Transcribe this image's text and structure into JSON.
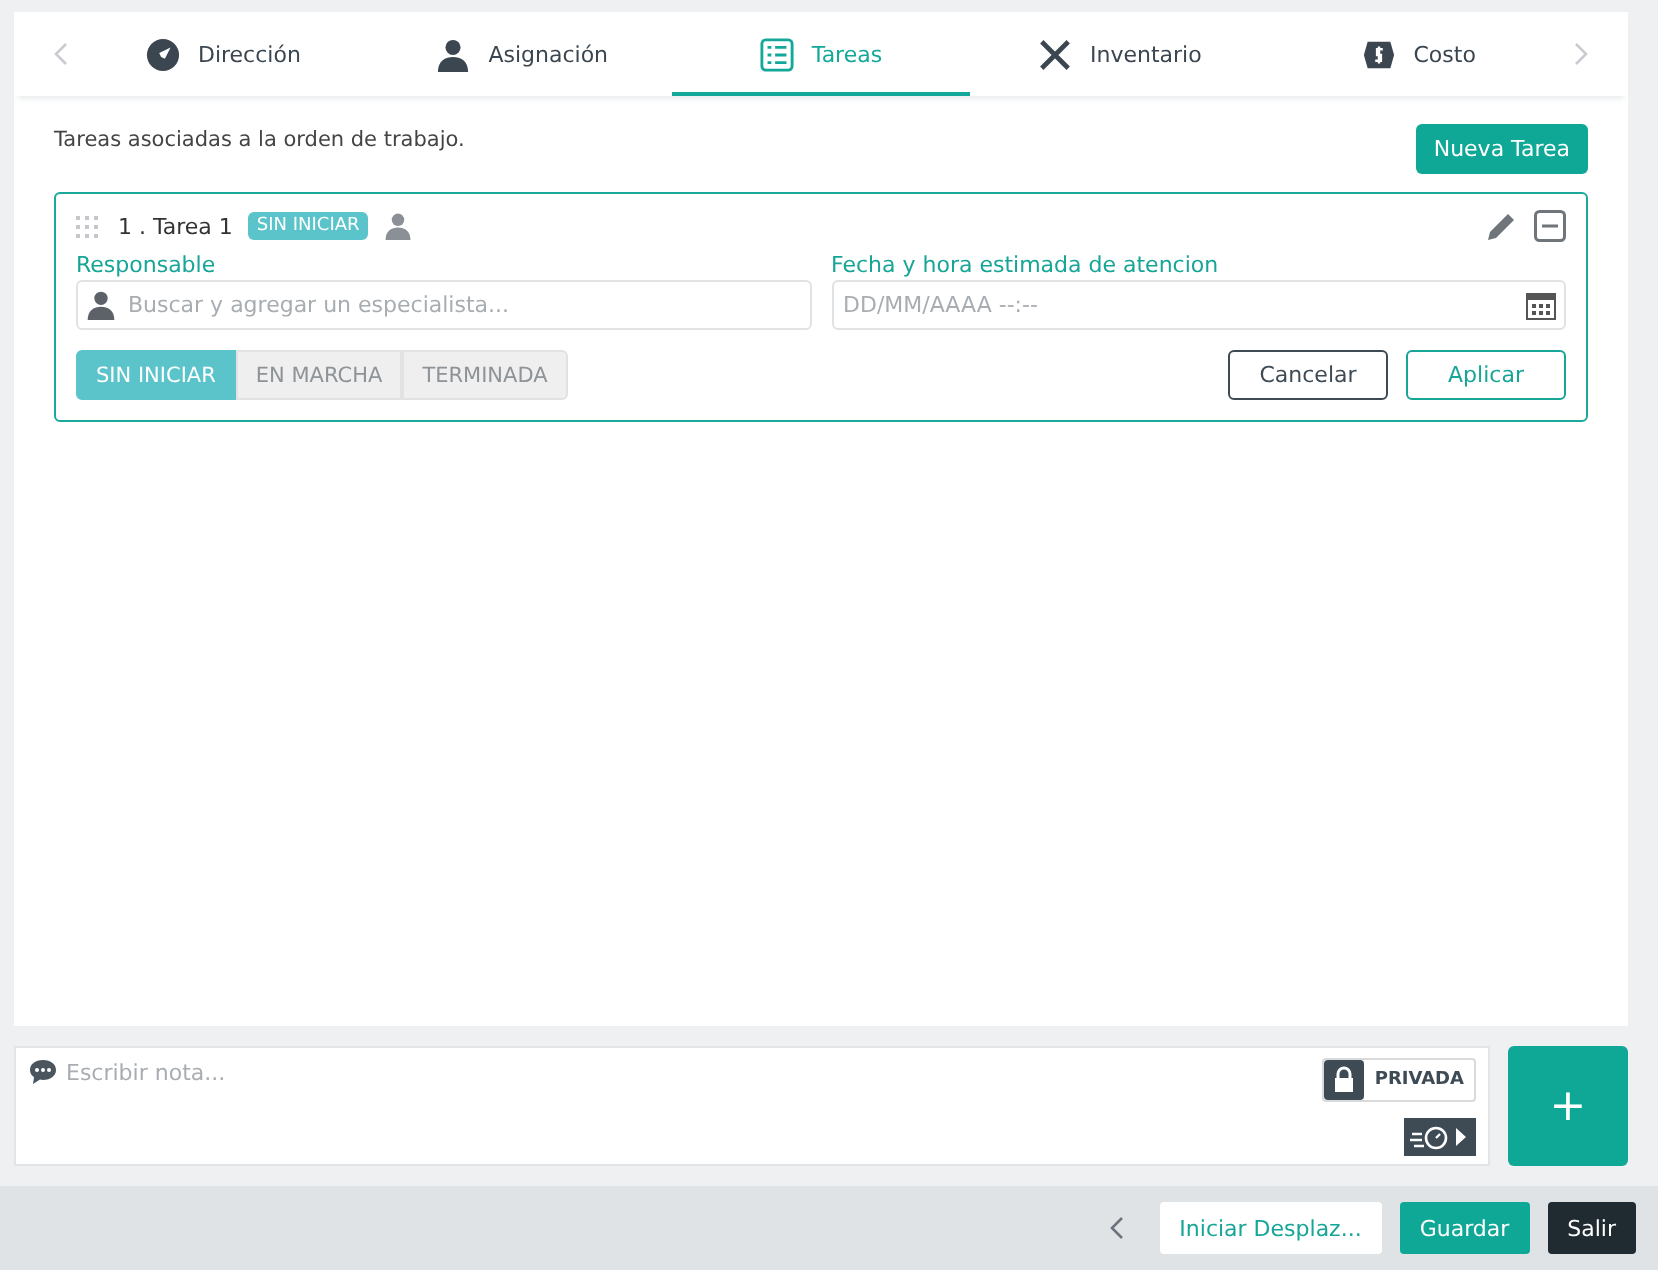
{
  "tabs": [
    {
      "label": "Dirección",
      "selected": false
    },
    {
      "label": "Asignación",
      "selected": false
    },
    {
      "label": "Tareas",
      "selected": true
    },
    {
      "label": "Inventario",
      "selected": false
    },
    {
      "label": "Costo",
      "selected": false
    }
  ],
  "intro": "Tareas asociadas a la orden de trabajo.",
  "new_task_button": "Nueva Tarea",
  "task": {
    "title": "1 . Tarea 1",
    "badge": "SIN INICIAR",
    "responsible_label": "Responsable",
    "responsible_placeholder": "Buscar y agregar un especialista...",
    "date_label": "Fecha y hora estimada de atencion",
    "date_placeholder": "DD/MM/AAAA --:--",
    "statuses": [
      {
        "label": "SIN INICIAR",
        "selected": true
      },
      {
        "label": "EN MARCHA",
        "selected": false
      },
      {
        "label": "TERMINADA",
        "selected": false
      }
    ],
    "cancel": "Cancelar",
    "apply": "Aplicar"
  },
  "note": {
    "placeholder": "Escribir nota...",
    "privacy": "PRIVADA",
    "add": "+"
  },
  "footer": {
    "start": "Iniciar Desplaz...",
    "save": "Guardar",
    "exit": "Salir"
  }
}
